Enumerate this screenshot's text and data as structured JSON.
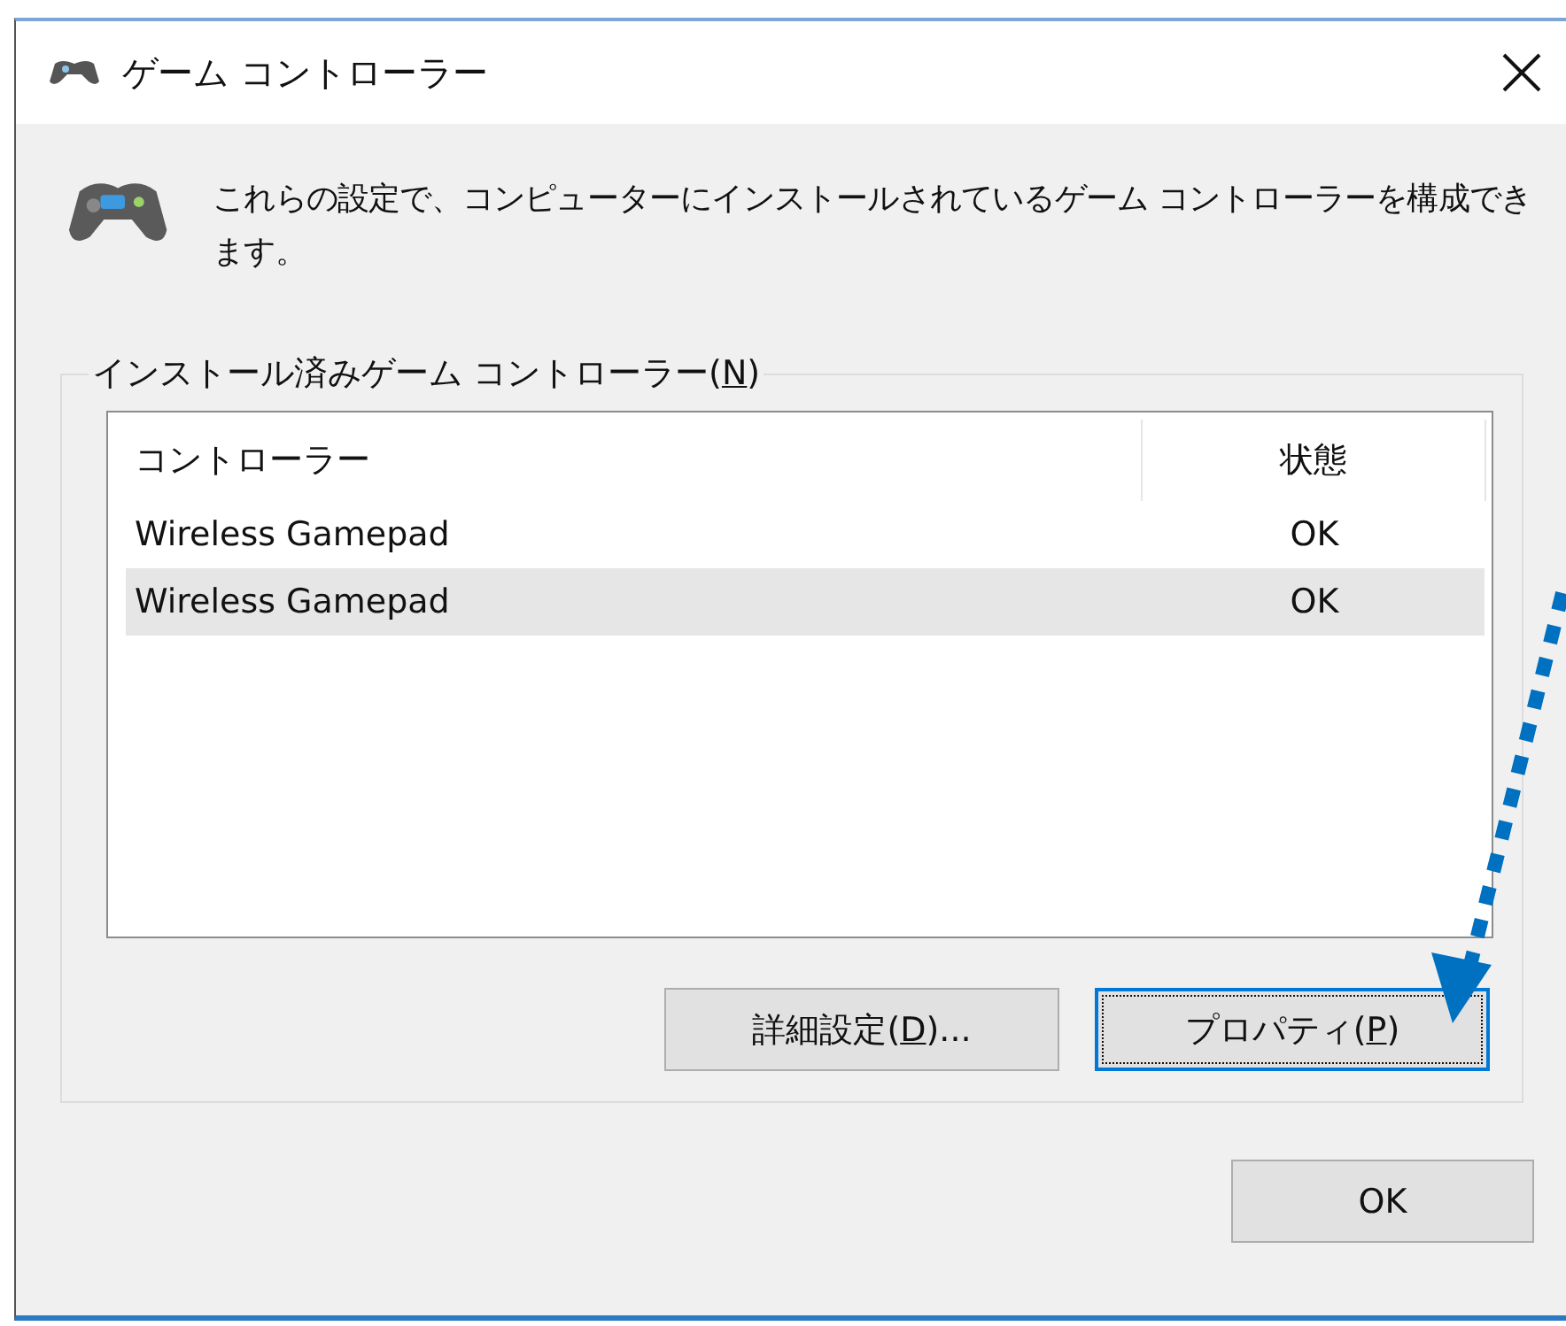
{
  "window": {
    "title": "ゲーム コントローラー"
  },
  "description": "これらの設定で、コンピューターにインストールされているゲーム コントローラーを構成できます。",
  "group": {
    "label": {
      "before": "インストール済みゲーム コントローラー(",
      "key": "N",
      "after": ")"
    }
  },
  "table": {
    "columns": [
      "コントローラー",
      "状態"
    ],
    "rows": [
      {
        "cells": [
          "Wireless Gamepad",
          "OK"
        ],
        "selected": false
      },
      {
        "cells": [
          "Wireless Gamepad",
          "OK"
        ],
        "selected": true
      }
    ]
  },
  "buttons": [
    {
      "before": "詳細設定(",
      "key": "D",
      "after": ")...",
      "focused": false
    },
    {
      "before": "プロパティ(",
      "key": "P",
      "after": ")",
      "focused": true
    }
  ],
  "ok_button": "OK"
}
